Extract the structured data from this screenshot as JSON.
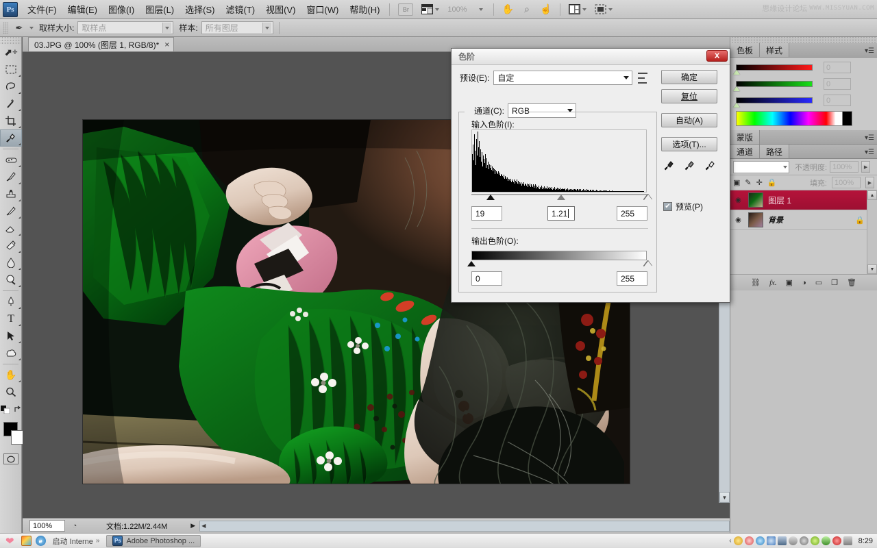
{
  "app": {
    "logo": "Ps",
    "watermark_cn": "思缘设计论坛",
    "watermark_en": "WWW.MISSYUAN.COM"
  },
  "menubar": {
    "items": [
      {
        "label": "文件(F)"
      },
      {
        "label": "编辑(E)"
      },
      {
        "label": "图像(I)"
      },
      {
        "label": "图层(L)"
      },
      {
        "label": "选择(S)"
      },
      {
        "label": "滤镜(T)"
      },
      {
        "label": "视图(V)"
      },
      {
        "label": "窗口(W)"
      },
      {
        "label": "帮助(H)"
      }
    ],
    "bridge_label": "Br",
    "zoom_label": "100%",
    "icons": [
      "view-arrange-icon",
      "hand-icon",
      "zoom-icon",
      "rotate-view-icon",
      "workspace-icon",
      "screen-mode-icon"
    ]
  },
  "optionsbar": {
    "tool_icon": "eyedropper-icon",
    "sample_size_label": "取样大小:",
    "sample_size_value": "取样点",
    "sample_label": "样本:",
    "sample_value": "所有图层"
  },
  "toolbar": {
    "tools": [
      {
        "name": "move-tool",
        "glyph": "⬌"
      },
      {
        "name": "rectangular-marquee-tool",
        "glyph": "⬚"
      },
      {
        "name": "lasso-tool",
        "glyph": "⟀"
      },
      {
        "name": "magic-wand-tool",
        "glyph": "✳"
      },
      {
        "name": "crop-tool",
        "glyph": "⛌"
      },
      {
        "name": "eyedropper-tool",
        "glyph": "✒",
        "selected": true
      },
      {
        "name": "healing-brush-tool",
        "glyph": "▱"
      },
      {
        "name": "brush-tool",
        "glyph": "✐"
      },
      {
        "name": "clone-stamp-tool",
        "glyph": "⚓"
      },
      {
        "name": "history-brush-tool",
        "glyph": "✎"
      },
      {
        "name": "eraser-tool",
        "glyph": "▰"
      },
      {
        "name": "gradient-tool",
        "glyph": "◢"
      },
      {
        "name": "blur-tool",
        "glyph": "Ὂ7"
      },
      {
        "name": "dodge-tool",
        "glyph": "◔"
      },
      {
        "name": "pen-tool",
        "glyph": "✑"
      },
      {
        "name": "type-tool",
        "glyph": "T"
      },
      {
        "name": "path-selection-tool",
        "glyph": "➤"
      },
      {
        "name": "shape-tool",
        "glyph": "⬟"
      },
      {
        "name": "hand-tool",
        "glyph": "✋"
      },
      {
        "name": "zoom-tool",
        "glyph": "⚲"
      }
    ],
    "foreground_color": "#000000",
    "background_color": "#ffffff",
    "quickmask_icon": "quick-mask-icon"
  },
  "document": {
    "tab_title": "03.JPG @ 100% (图层 1, RGB/8)*",
    "tab_close": "×",
    "status_zoom": "100%",
    "status_doc": "文档:1.22M/2.44M"
  },
  "dialog": {
    "title": "色阶",
    "close_label": "X",
    "preset_label": "预设(E):",
    "preset_value": "自定",
    "preset_options_icon": "preset-options-icon",
    "channel_label": "通道(C):",
    "channel_value": "RGB",
    "input_levels_label": "输入色阶(I):",
    "input_black": "19",
    "input_gamma": "1.21",
    "input_white": "255",
    "output_levels_label": "输出色阶(O):",
    "output_black": "0",
    "output_white": "255",
    "buttons": {
      "ok": "确定",
      "reset": "复位",
      "auto": "自动(A)",
      "options": "选项(T)..."
    },
    "eyedroppers": [
      "set-black-point-eyedropper",
      "set-gray-point-eyedropper",
      "set-white-point-eyedropper"
    ],
    "preview_label": "预览(P)",
    "preview_checked": true,
    "histogram": [
      62,
      78,
      52,
      95,
      68,
      44,
      88,
      60,
      100,
      74,
      46,
      84,
      58,
      70,
      50,
      66,
      42,
      60,
      54,
      48,
      62,
      40,
      56,
      44,
      50,
      38,
      46,
      40,
      44,
      36,
      42,
      34,
      40,
      32,
      38,
      30,
      36,
      34,
      32,
      30,
      34,
      28,
      32,
      26,
      30,
      28,
      26,
      24,
      28,
      22,
      26,
      24,
      22,
      20,
      24,
      18,
      22,
      20,
      18,
      22,
      16,
      20,
      18,
      16,
      20,
      14,
      18,
      16,
      20,
      14,
      18,
      12,
      16,
      14,
      12,
      16,
      10,
      14,
      12,
      16,
      10,
      14,
      12,
      10,
      14,
      8,
      12,
      10,
      14,
      8,
      12,
      10,
      8,
      12,
      7,
      10,
      8,
      12,
      6,
      10,
      8,
      6,
      10,
      5,
      8,
      6,
      10,
      4,
      8,
      6,
      9,
      5,
      7,
      6,
      9,
      4,
      7,
      5,
      8,
      4,
      7,
      5,
      8,
      3,
      6,
      5,
      8,
      3,
      6,
      4,
      7,
      3,
      6,
      4,
      7,
      3,
      5,
      4,
      6,
      3,
      5,
      4,
      6,
      2,
      5,
      3,
      6,
      2,
      5,
      3,
      5,
      2,
      4,
      3,
      5,
      2,
      4,
      3,
      5,
      2,
      4,
      2,
      4,
      2,
      4,
      2,
      4,
      1,
      3,
      2,
      4,
      1,
      3,
      2,
      4,
      1,
      3,
      2,
      3,
      1,
      3,
      1,
      3,
      1,
      3,
      1,
      3,
      1,
      2,
      1,
      3,
      1,
      2,
      1,
      2,
      1,
      2,
      1,
      2,
      1,
      2,
      1,
      2,
      1,
      2,
      1,
      2,
      1,
      1,
      1,
      2,
      1,
      1,
      1,
      2,
      1,
      1,
      1,
      1,
      1,
      1,
      1,
      1,
      1,
      1,
      1,
      1,
      1,
      1,
      1,
      1,
      1,
      1,
      1,
      1,
      1,
      1,
      1,
      1,
      1,
      1,
      1,
      1,
      1,
      1,
      1,
      1,
      1,
      1,
      1,
      1,
      1,
      1,
      1,
      1,
      1,
      1,
      1,
      1,
      1,
      1,
      1,
      1
    ]
  },
  "panels": {
    "color_tabs": [
      {
        "label": "色板",
        "active": false
      },
      {
        "label": "样式",
        "active": false
      }
    ],
    "color_sliders": [
      {
        "name": "red-slider",
        "value": "0",
        "color": "#ff1a1a"
      },
      {
        "name": "green-slider",
        "value": "0",
        "color": "#18e018"
      },
      {
        "name": "blue-slider",
        "value": "0",
        "color": "#2a2aff"
      }
    ],
    "mask_tabs": [
      {
        "label": "蒙版",
        "active": false
      }
    ],
    "channel_tabs": [
      {
        "label": "通道",
        "active": false
      },
      {
        "label": "路径",
        "active": false
      }
    ],
    "opacity_label": "不透明度:",
    "opacity_value": "100%",
    "fill_label": "填充:",
    "fill_value": "100%",
    "lock_icons": [
      "lock-transparency-icon",
      "lock-image-icon",
      "lock-position-icon",
      "lock-all-icon"
    ],
    "layers": [
      {
        "name": "图层 1",
        "selected": true,
        "locked": false,
        "italic": false
      },
      {
        "name": "背景",
        "selected": false,
        "locked": true,
        "italic": true
      }
    ],
    "footer_icons": [
      "link-layers-icon",
      "add-style-fx-icon",
      "add-mask-icon",
      "new-adjustment-icon",
      "new-group-icon",
      "new-layer-icon",
      "delete-layer-icon"
    ],
    "selected_layer_color": "#a8123a"
  },
  "taskbar": {
    "start_icon": "heart-start-icon",
    "quick_launch": [
      {
        "name": "image-viewer-icon",
        "label": ""
      },
      {
        "name": "internet-explorer-icon",
        "label": "启动 Interne"
      }
    ],
    "chevron": "»",
    "tasks": [
      {
        "icon": "photoshop-icon",
        "label": "Adobe Photoshop ...",
        "active": true
      }
    ],
    "tray_icons": [
      "chevron-left-icon",
      "money-icon",
      "qq-icon",
      "globe-icon",
      "network-icon",
      "monitor-icon",
      "mouse-icon",
      "disc-icon",
      "update-icon",
      "shield-icon",
      "opera-icon",
      "hdd-icon"
    ],
    "clock": "8:29"
  }
}
